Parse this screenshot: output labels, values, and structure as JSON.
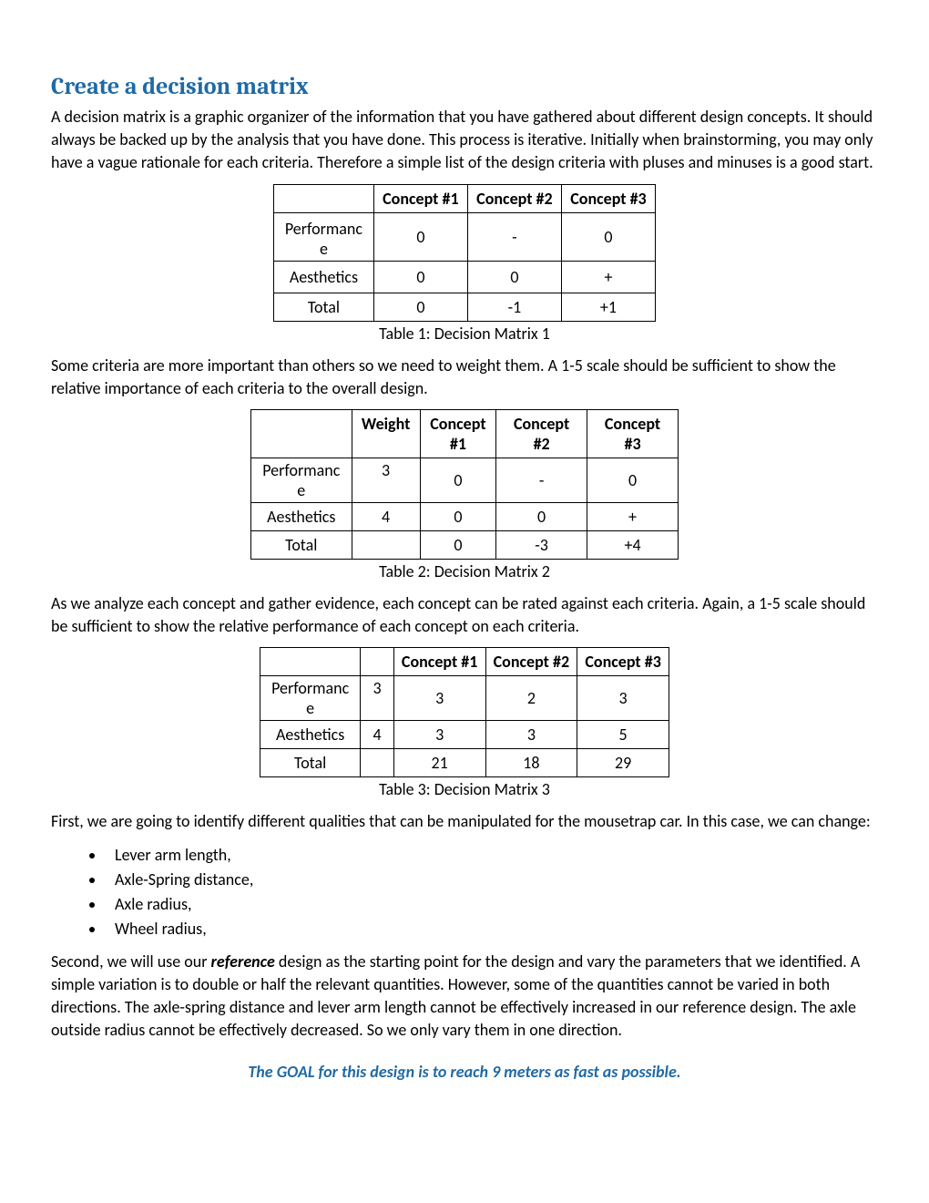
{
  "title": "Create a decision matrix",
  "para1": "A decision matrix is a graphic organizer of the information that you have gathered about different design concepts.  It should always be backed up by the analysis that you have done.  This process is iterative.  Initially when brainstorming, you may only have a vague rationale for each criteria.  Therefore a simple list of the design criteria with pluses and minuses is a good start.",
  "table1": {
    "headers": [
      "",
      "Concept #1",
      "Concept #2",
      "Concept #3"
    ],
    "rows": [
      [
        "Performance",
        "0",
        "-",
        "0"
      ],
      [
        "Aesthetics",
        "0",
        "0",
        "+"
      ],
      [
        "Total",
        "0",
        "-1",
        "+1"
      ]
    ],
    "caption": "Table 1: Decision Matrix 1"
  },
  "para2": "Some criteria are more important than others so we need to weight them.  A 1-5 scale should be sufficient to show the relative importance of each criteria to the overall design.",
  "table2": {
    "headers": [
      "",
      "Weight",
      "Concept #1",
      "Concept #2",
      "Concept #3"
    ],
    "rows": [
      [
        "Performance",
        "3",
        "0",
        "-",
        "0"
      ],
      [
        "Aesthetics",
        "4",
        "0",
        "0",
        "+"
      ],
      [
        "Total",
        "",
        "0",
        "-3",
        "+4"
      ]
    ],
    "caption": "Table 2: Decision Matrix 2"
  },
  "para3": "As we analyze each concept and gather evidence, each concept can be rated against each criteria.  Again, a 1-5 scale should be sufficient to show the relative performance of each concept on each criteria.",
  "table3": {
    "headers": [
      "",
      "",
      "Concept #1",
      "Concept #2",
      "Concept #3"
    ],
    "rows": [
      [
        "Performance",
        "3",
        "3",
        "2",
        "3"
      ],
      [
        "Aesthetics",
        "4",
        "3",
        "3",
        "5"
      ],
      [
        "Total",
        "",
        "21",
        "18",
        "29"
      ]
    ],
    "caption": "Table 3: Decision Matrix 3"
  },
  "para4": "First, we are going to identify different qualities that can be manipulated for the mousetrap car.  In this case, we can change:",
  "bullets": [
    "Lever arm length,",
    "Axle-Spring distance,",
    "Axle radius,",
    "Wheel radius,"
  ],
  "para5_pre": "Second, we will use our ",
  "para5_ref": "reference",
  "para5_post": " design as the starting point for the design and vary the parameters that we identified.  A simple variation is to double or half the relevant quantities.  However, some of the quantities cannot be varied in both directions.  The axle-spring distance and lever arm length cannot be effectively increased in our reference design.  The axle outside radius cannot be effectively decreased.  So we only vary them in one direction.",
  "goal": "The GOAL for this design is to reach 9 meters as fast as possible."
}
